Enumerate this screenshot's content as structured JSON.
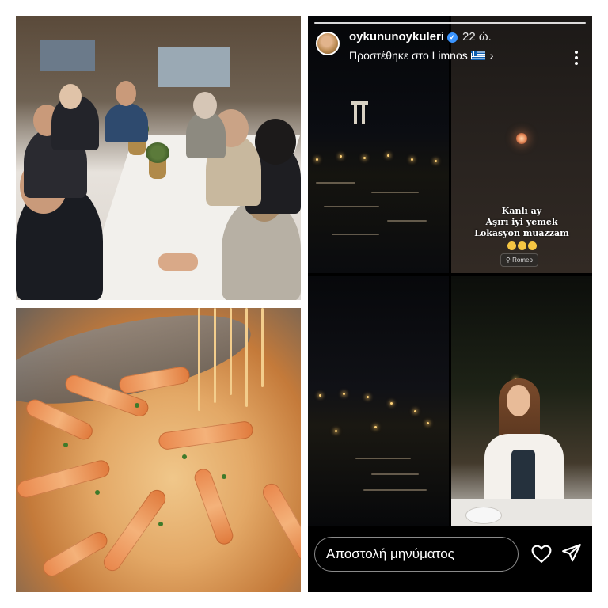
{
  "story": {
    "username": "oykununoykuleri",
    "time": "22 ώ.",
    "added_text": "Προστέθηκε στο Limnos",
    "caption_lines": [
      "Kanlı ay",
      "Aşırı iyi yemek",
      "Lokasyon muazzam"
    ],
    "location_tag": "Romeo",
    "reply_placeholder": "Αποστολή μηνύματος",
    "icons": [
      "verified-badge-icon",
      "greek-flag-icon",
      "chevron-right-icon",
      "more-options-icon",
      "location-pin-icon",
      "heart-icon",
      "send-icon"
    ],
    "colors": {
      "verified": "#3b95ff",
      "background": "#000000"
    }
  }
}
